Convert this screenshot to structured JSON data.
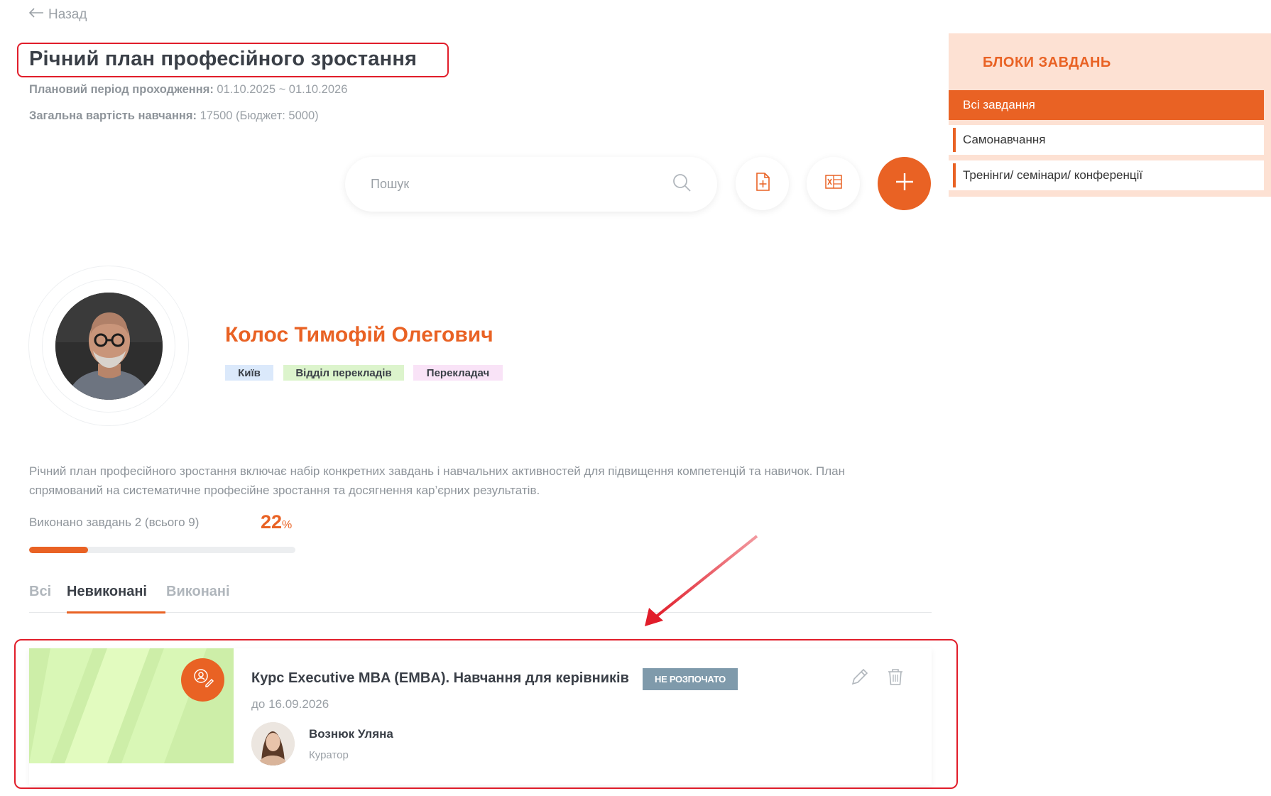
{
  "back": {
    "label": "Назад"
  },
  "plan": {
    "title": "Річний план професійного зростання",
    "period_label": "Плановий період проходження:",
    "period_value": "01.10.2025 ~ 01.10.2026",
    "cost_label": "Загальна вартість навчання:",
    "cost_value": "17500 (Бюджет: 5000)"
  },
  "search": {
    "placeholder": "Пошук"
  },
  "sidebar": {
    "title": "БЛОКИ ЗАВДАНЬ",
    "items": [
      {
        "label": "Всі завдання",
        "active": true
      },
      {
        "label": "Самонавчання",
        "active": false
      },
      {
        "label": "Тренінги/ семінари/ конференції",
        "active": false
      }
    ]
  },
  "profile": {
    "name": "Колос Тимофій Олегович",
    "tags": [
      {
        "label": "Київ",
        "color": "#dbe9fb"
      },
      {
        "label": "Відділ перекладів",
        "color": "#dcf4cc"
      },
      {
        "label": "Перекладач",
        "color": "#f9e3f7"
      }
    ]
  },
  "description": {
    "line1": "Річний план професійного зростання включає набір конкретних завдань і навчальних активностей для підвищення компетенцій та навичок. План",
    "line2": "спрямований на систематичне професійне зростання та досягнення кар’єрних результатів."
  },
  "progress": {
    "label": "Виконано завдань 2 (всього 9)",
    "percent_value": "22",
    "percent_sign": "%",
    "fraction": 0.22
  },
  "tabs": [
    {
      "label": "Всі",
      "active": false
    },
    {
      "label": "Невиконані",
      "active": true
    },
    {
      "label": "Виконані",
      "active": false
    }
  ],
  "task": {
    "title": "Курс Executive MBA (EMBA). Навчання для керівників",
    "status": "НЕ РОЗПОЧАТО",
    "due": "до 16.09.2026",
    "curator_name": "Вознюк Уляна",
    "curator_role": "Куратор"
  },
  "colors": {
    "accent": "#e96224",
    "highlight_red": "#e11d2a",
    "sidebar_bg": "#fde1d3",
    "status_bg": "#7f9aab"
  },
  "icons": [
    "arrow-left-icon",
    "search-icon",
    "file-add-icon",
    "excel-icon",
    "plus-icon",
    "training-icon",
    "edit-icon",
    "trash-icon"
  ]
}
